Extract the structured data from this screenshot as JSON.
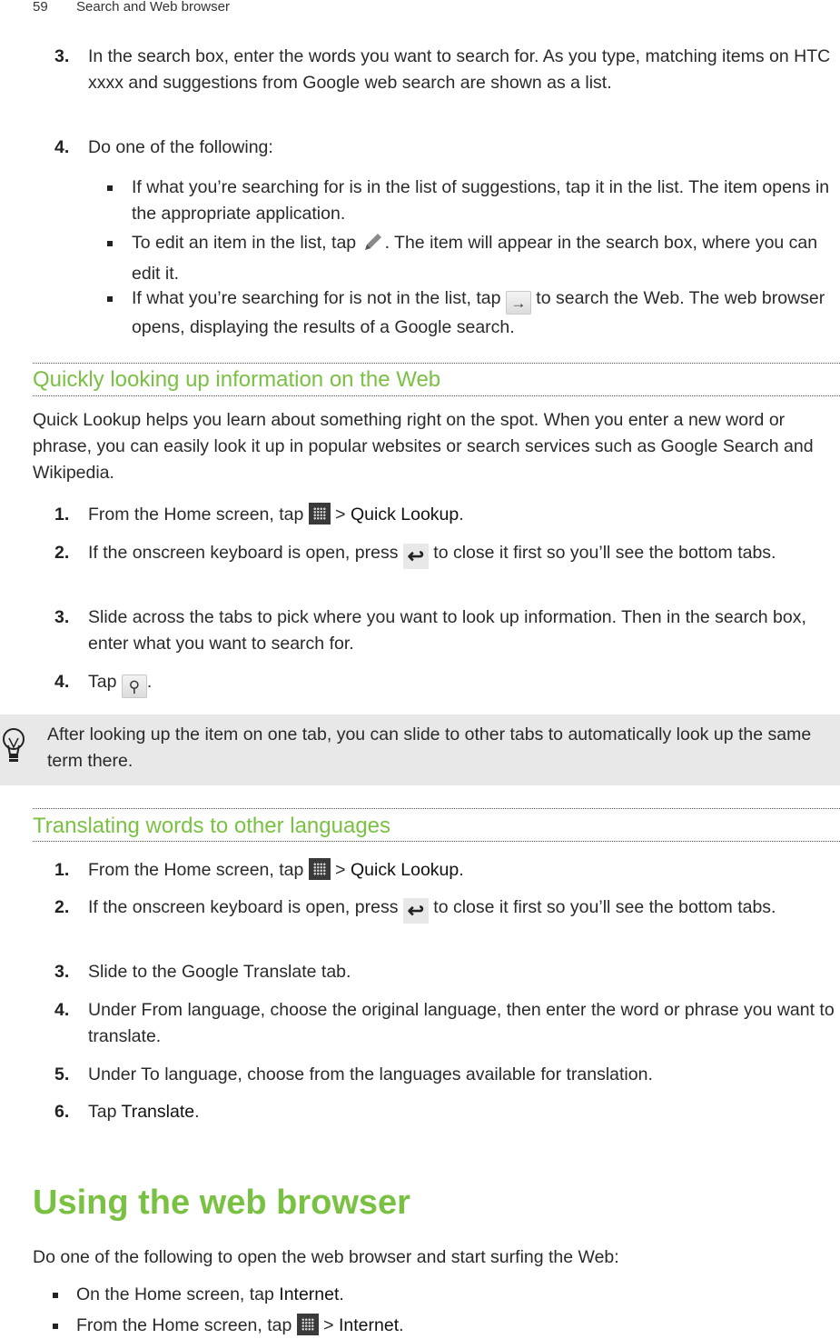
{
  "header": {
    "page_number": "59",
    "chapter": "Search and Web browser"
  },
  "intro_steps": [
    {
      "n": "3.",
      "text": "In the search box, enter the words you want to search for. As you type, matching items on HTC xxxx and suggestions from Google web search are shown as a list."
    },
    {
      "n": "4.",
      "text": "Do one of the following:"
    }
  ],
  "intro_bullets": [
    {
      "text": "If what you’re searching for is in the list of suggestions, tap it in the list. The item opens in the appropriate application."
    },
    {
      "pre": "To edit an item in the list, tap ",
      "icon": "pencil-icon",
      "post": ". The item will appear in the search box, where you can edit it."
    },
    {
      "pre": "If what you’re searching for is not in the list, tap ",
      "icon": "arrow-right-icon",
      "post": " to search the Web. The web browser opens, displaying the results of a Google search."
    }
  ],
  "section_quick": {
    "title": "Quickly looking up information on the Web",
    "intro": "Quick Lookup helps you learn about something right on the spot. When you enter a new word or phrase, you can easily look it up in popular websites or search services such as Google Search and Wikipedia.",
    "steps": [
      {
        "n": "1.",
        "pre": "From the Home screen, tap ",
        "icon": "all-apps-icon",
        "mid": " > ",
        "bold": "Quick Lookup",
        "post": "."
      },
      {
        "n": "2.",
        "pre": "If the onscreen keyboard is open, press ",
        "icon": "back-icon",
        "post": " to close it first so you’ll see the bottom tabs."
      },
      {
        "n": "3.",
        "text": "Slide across the tabs to pick where you want to look up information. Then in the search box, enter what you want to search for."
      },
      {
        "n": "4.",
        "pre": "Tap ",
        "icon": "search-icon",
        "post": "."
      }
    ],
    "tip": "After looking up the item on one tab, you can slide to other tabs to automatically look up the same term there."
  },
  "section_translate": {
    "title": "Translating words to other languages",
    "steps": [
      {
        "n": "1.",
        "pre": "From the Home screen, tap ",
        "icon": "all-apps-icon",
        "mid": " > ",
        "bold": "Quick Lookup",
        "post": "."
      },
      {
        "n": "2.",
        "pre": "If the onscreen keyboard is open, press ",
        "icon": "back-icon",
        "post": " to close it first so you’ll see the bottom tabs."
      },
      {
        "n": "3.",
        "text": "Slide to the Google Translate tab."
      },
      {
        "n": "4.",
        "text": "Under From language, choose the original language, then enter the word or phrase you want to translate."
      },
      {
        "n": "5.",
        "text": "Under To language, choose from the languages available for translation."
      },
      {
        "n": "6.",
        "pre": "Tap ",
        "bold": "Translate",
        "post": "."
      }
    ]
  },
  "section_browser": {
    "title": "Using the web browser",
    "intro": "Do one of the following to open the web browser and start surfing the Web:",
    "bullets": [
      {
        "pre": "On the Home screen, tap ",
        "bold": "Internet",
        "post": "."
      },
      {
        "pre": "From the Home screen, tap ",
        "icon": "all-apps-icon",
        "mid": " > ",
        "bold": "Internet",
        "post": "."
      }
    ]
  },
  "colors": {
    "accent_green": "#7ac143",
    "tip_background": "#e8e8e8"
  }
}
